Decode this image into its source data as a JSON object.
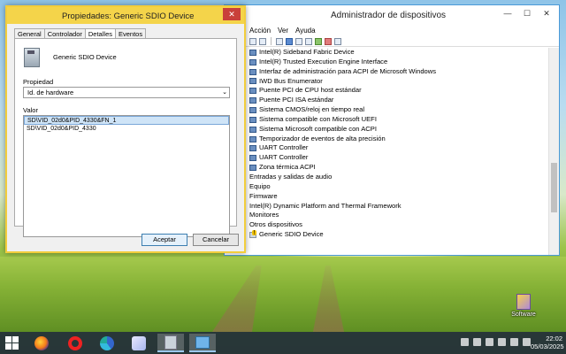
{
  "devmgr": {
    "title": "Administrador de dispositivos",
    "menu": [
      "Acción",
      "Ver",
      "Ayuda"
    ],
    "tree": [
      {
        "label": "Intel(R) Sideband Fabric Device",
        "kind": "child"
      },
      {
        "label": "Intel(R) Trusted Execution Engine Interface",
        "kind": "child"
      },
      {
        "label": "Interfaz de administración para ACPI de Microsoft Windows",
        "kind": "child"
      },
      {
        "label": "IWD Bus Enumerator",
        "kind": "child"
      },
      {
        "label": "Puente PCI de CPU host estándar",
        "kind": "child"
      },
      {
        "label": "Puente PCI ISA estándar",
        "kind": "child"
      },
      {
        "label": "Sistema CMOS/reloj en tiempo real",
        "kind": "child"
      },
      {
        "label": "Sistema compatible con Microsoft UEFI",
        "kind": "child"
      },
      {
        "label": "Sistema Microsoft compatible con ACPI",
        "kind": "child"
      },
      {
        "label": "Temporizador de eventos de alta precisión",
        "kind": "child"
      },
      {
        "label": "UART Controller",
        "kind": "child"
      },
      {
        "label": "UART Controller",
        "kind": "child"
      },
      {
        "label": "Zona térmica ACPI",
        "kind": "child"
      },
      {
        "label": "Entradas y salidas de audio",
        "kind": "cat"
      },
      {
        "label": "Equipo",
        "kind": "cat"
      },
      {
        "label": "Firmware",
        "kind": "cat"
      },
      {
        "label": "Intel(R) Dynamic Platform and Thermal Framework",
        "kind": "cat"
      },
      {
        "label": "Monitores",
        "kind": "cat"
      },
      {
        "label": "Otros dispositivos",
        "kind": "cat"
      },
      {
        "label": "Generic SDIO Device",
        "kind": "dev"
      }
    ]
  },
  "props": {
    "title": "Propiedades: Generic SDIO Device",
    "close": "✕",
    "tabs": [
      "General",
      "Controlador",
      "Detalles",
      "Eventos"
    ],
    "active_tab": "Detalles",
    "device_name": "Generic SDIO Device",
    "property_label": "Propiedad",
    "property_value": "Id. de hardware",
    "value_label": "Valor",
    "values": [
      "SD\\VID_02d0&PID_4330&FN_1",
      "SD\\VID_02d0&PID_4330"
    ],
    "ok_label": "Aceptar",
    "cancel_label": "Cancelar"
  },
  "desktop": {
    "icon_label": "Software"
  },
  "taskbar": {
    "time": "22:02",
    "date": "05/03/2025"
  }
}
